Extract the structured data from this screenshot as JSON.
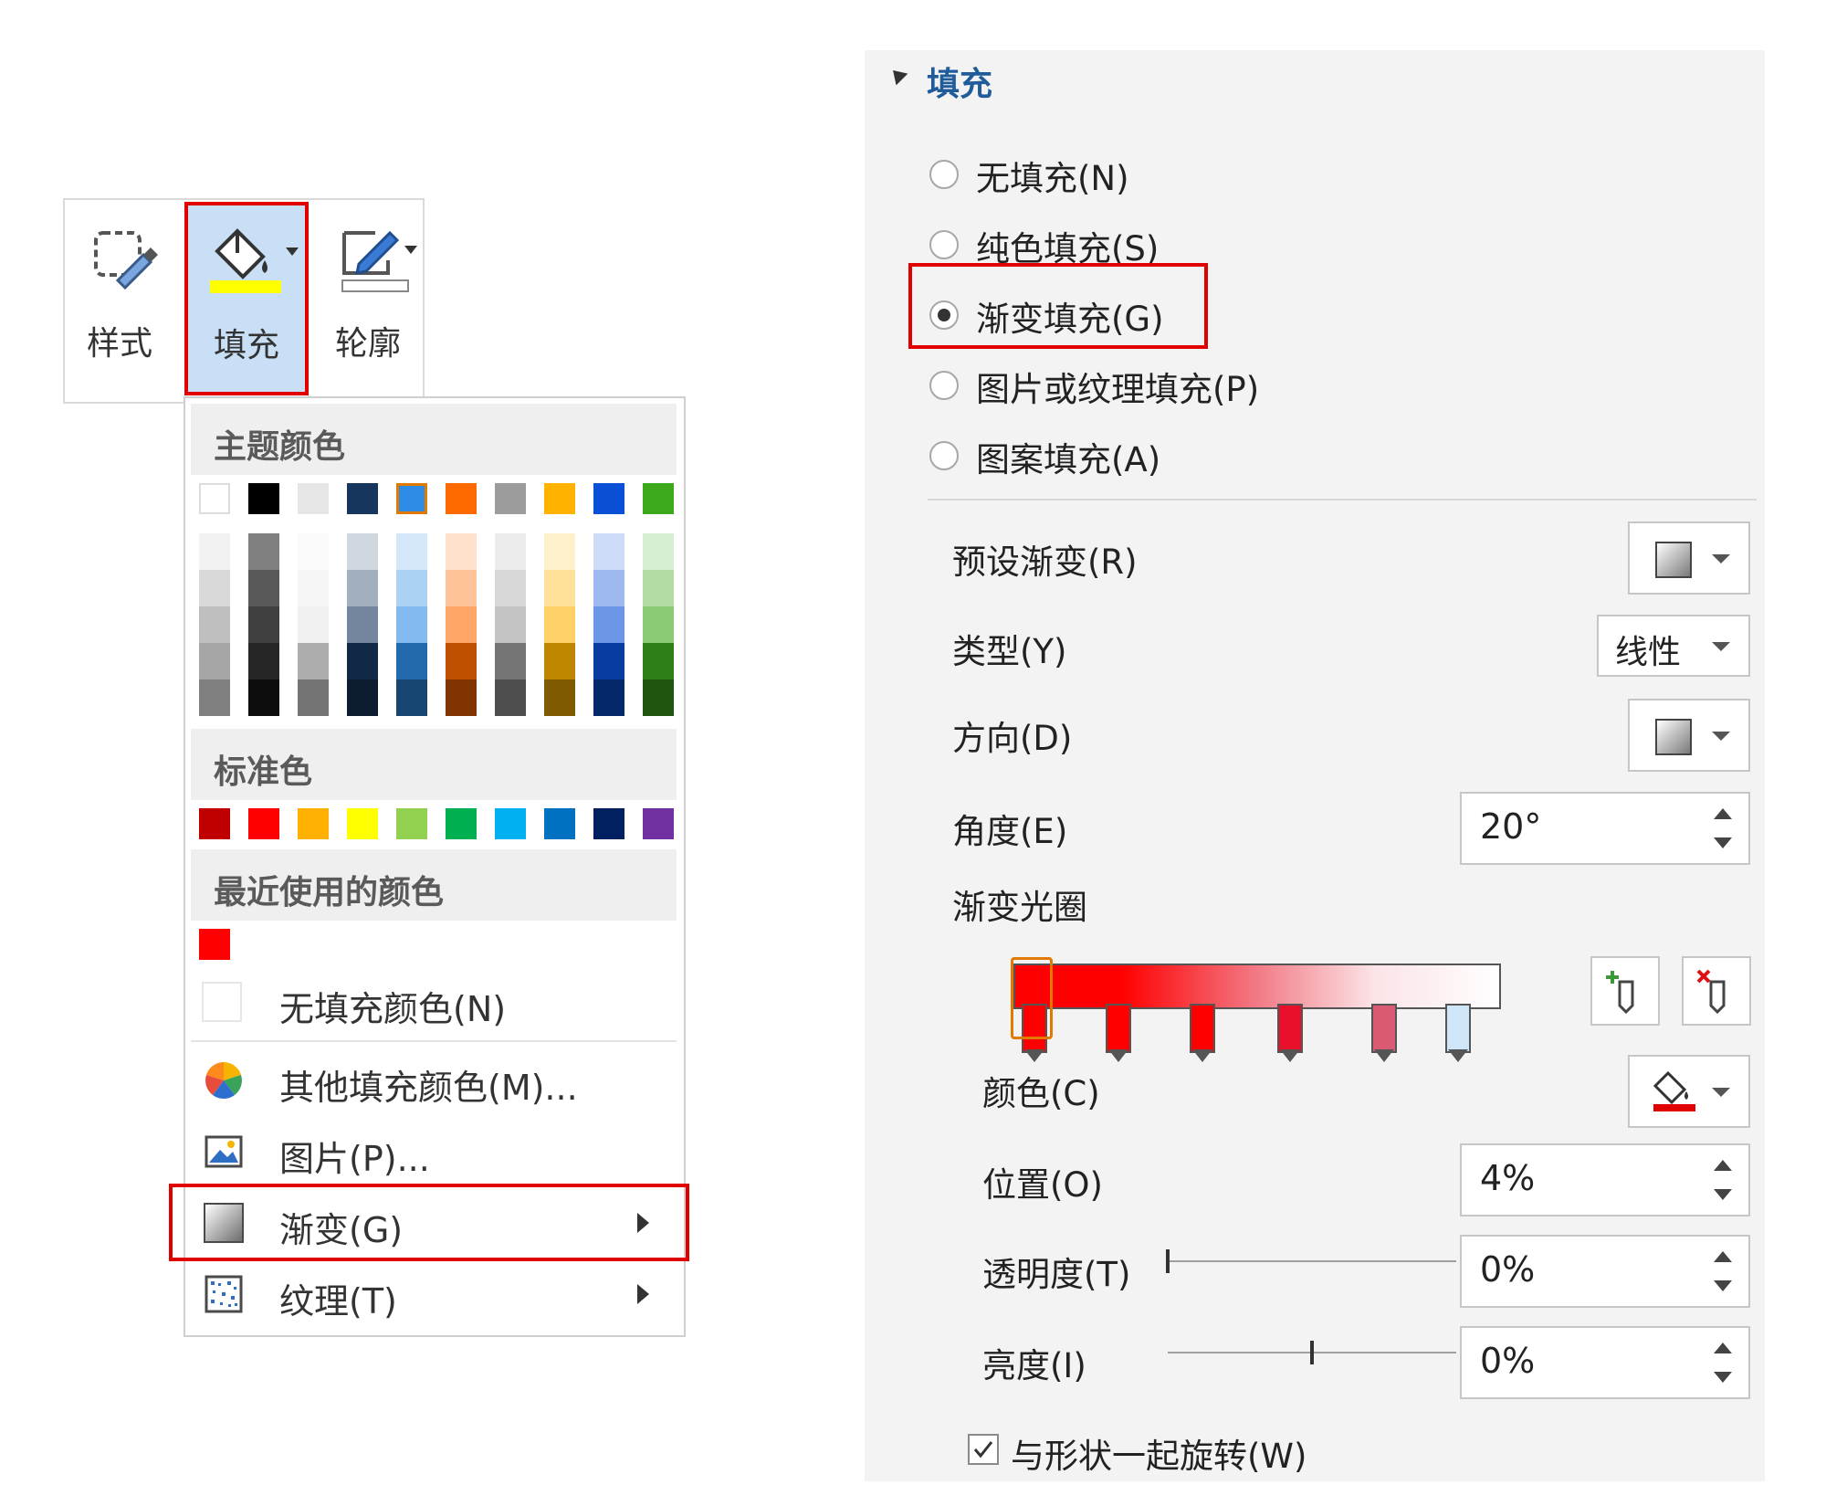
{
  "ribbon": {
    "style_label": "样式",
    "fill_label": "填充",
    "outline_label": "轮廓"
  },
  "menu": {
    "theme_colors_heading": "主题颜色",
    "theme_top_row": [
      "#ffffff",
      "#000000",
      "#e6e6e6",
      "#17365d",
      "#2e8ce6",
      "#ff6a00",
      "#9c9c9c",
      "#ffb300",
      "#0a50d6",
      "#3ea81c"
    ],
    "standard_heading": "标准色",
    "standard_colors": [
      "#c00000",
      "#ff0000",
      "#ffb000",
      "#ffff00",
      "#92d050",
      "#00b050",
      "#00b0f0",
      "#0070c0",
      "#002060",
      "#7030a0"
    ],
    "recent_heading": "最近使用的颜色",
    "recent_colors": [
      "#ff0000"
    ],
    "no_fill": "无填充颜色(N)",
    "more_fill": "其他填充颜色(M)...",
    "picture": "图片(P)...",
    "gradient": "渐变(G)",
    "texture": "纹理(T)"
  },
  "panel": {
    "section_title": "填充",
    "options": [
      "无填充(N)",
      "纯色填充(S)",
      "渐变填充(G)",
      "图片或纹理填充(P)",
      "图案填充(A)"
    ],
    "selected_option": "渐变填充(G)",
    "preset_label": "预设渐变(R)",
    "type_label": "类型(Y)",
    "type_value": "线性",
    "direction_label": "方向(D)",
    "angle_label": "角度(E)",
    "angle_value": "20°",
    "stops_label": "渐变光圈",
    "color_label": "颜色(C)",
    "position_label": "位置(O)",
    "position_value": "4%",
    "transparency_label": "透明度(T)",
    "transparency_value": "0%",
    "transparency_level": 0,
    "brightness_label": "亮度(I)",
    "brightness_value": "0%",
    "brightness_level": 0.5,
    "rotate_label": "与形状一起旋转(W)",
    "rotate_checked": true,
    "accent_red": "#e00000"
  }
}
